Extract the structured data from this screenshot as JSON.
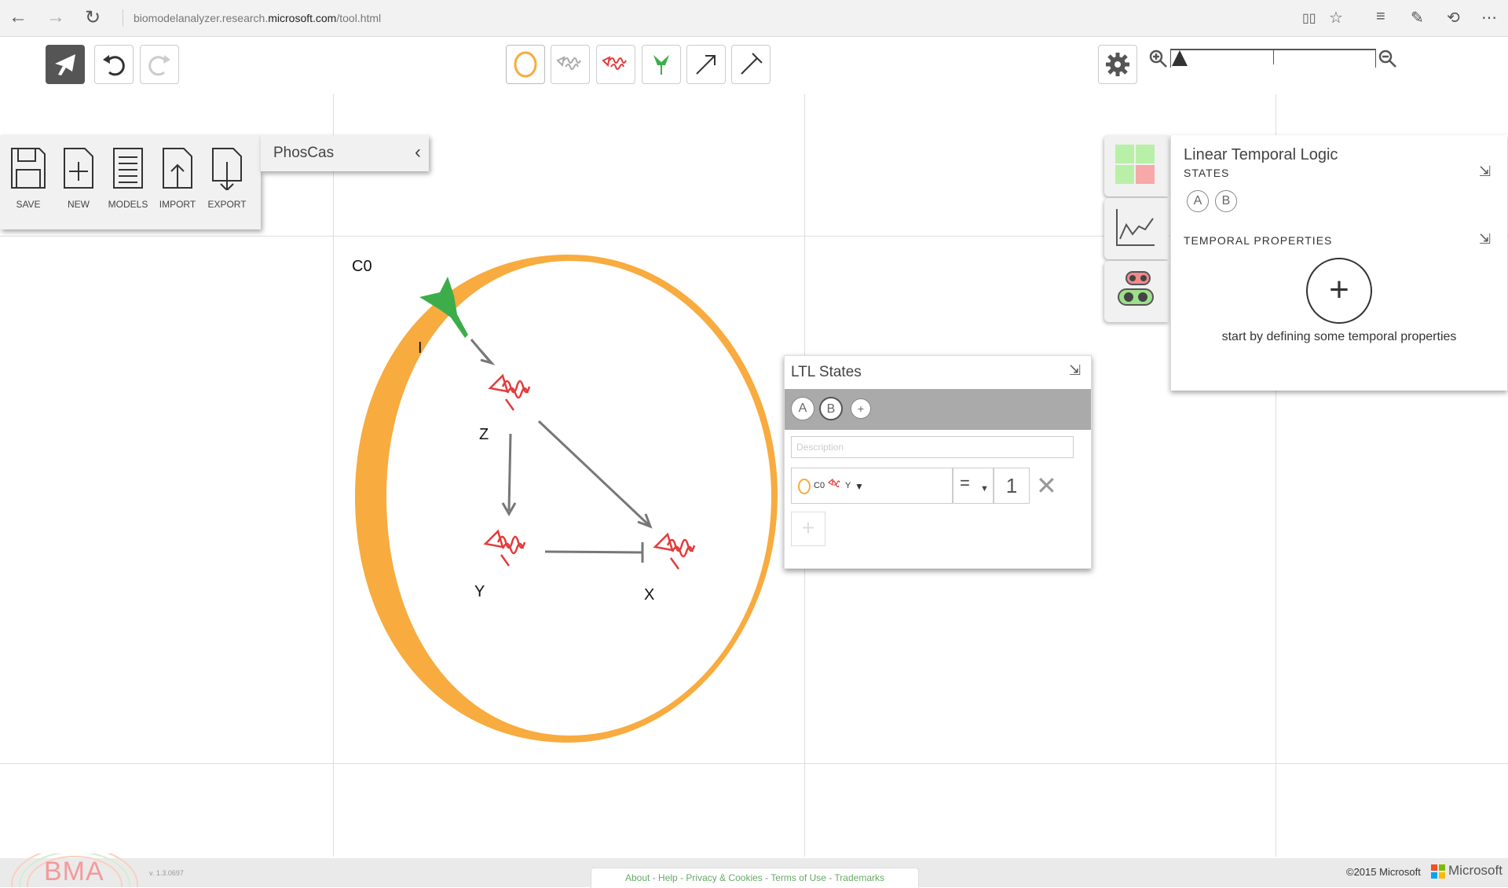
{
  "browser": {
    "url_prefix": "biomodelanalyzer.research.",
    "url_domain": "microsoft.com",
    "url_path": "/tool.html"
  },
  "file_menu": {
    "items": [
      {
        "label": "SAVE",
        "icon": "save-icon"
      },
      {
        "label": "NEW",
        "icon": "new-file-icon"
      },
      {
        "label": "MODELS",
        "icon": "models-list-icon"
      },
      {
        "label": "IMPORT",
        "icon": "import-icon"
      },
      {
        "label": "EXPORT",
        "icon": "export-icon"
      }
    ],
    "model_name": "PhosCas"
  },
  "canvas": {
    "container_label": "C0",
    "receptor_label": "I",
    "variables": {
      "z": "Z",
      "y": "Y",
      "x": "X"
    },
    "colors": {
      "cell": "#f8ab3e",
      "variable": "#e33b3b",
      "receptor": "#3cad4a",
      "arrow": "#777777"
    }
  },
  "ltl_panel": {
    "title": "Linear Temporal Logic",
    "states_heading": "STATES",
    "states": [
      "A",
      "B"
    ],
    "temporal_heading": "TEMPORAL PROPERTIES",
    "hint": "start by defining some temporal properties"
  },
  "ltl_states_window": {
    "title": "LTL States",
    "tabs": [
      "A",
      "B"
    ],
    "add_tab": "+",
    "description_placeholder": "Description",
    "formula_container": "C0",
    "formula_variable": "Y",
    "operator": "=",
    "value": "1",
    "add_row": "+"
  },
  "footer": {
    "logo_text": "BMA",
    "version": "v. 1.3.0697",
    "links": [
      "About",
      "Help",
      "Privacy & Cookies",
      "Terms of Use",
      "Trademarks"
    ],
    "copyright": "©2015 Microsoft",
    "brand": "Microsoft"
  }
}
